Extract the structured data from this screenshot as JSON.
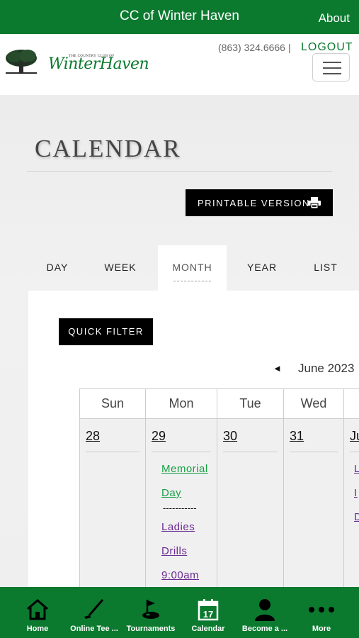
{
  "topbar": {
    "title": "CC of Winter Haven",
    "about": "About"
  },
  "header": {
    "logo_small": "THE COUNTRY CLUB OF",
    "logo_main": "WinterHaven",
    "phone": "(863) 324.6666",
    "separator": "|",
    "logout": "LOGOUT"
  },
  "page": {
    "title": "CALENDAR",
    "print_label": "PRINTABLE VERSION"
  },
  "tabs": [
    {
      "label": "DAY",
      "active": false
    },
    {
      "label": "WEEK",
      "active": false
    },
    {
      "label": "MONTH",
      "active": true
    },
    {
      "label": "YEAR",
      "active": false
    },
    {
      "label": "LIST",
      "active": false
    }
  ],
  "calendar": {
    "quick_filter": "QUICK FILTER",
    "prev_arrow": "◄",
    "month_label": "June 2023",
    "day_headers": [
      "Sun",
      "Mon",
      "Tue",
      "Wed",
      ""
    ],
    "days": [
      {
        "num": "28",
        "events": []
      },
      {
        "num": "29",
        "events": [
          {
            "text": "Memorial",
            "color": "green"
          },
          {
            "text": "Day",
            "color": "green"
          },
          {
            "text": "Ladies",
            "color": "purple"
          },
          {
            "text": "Drills",
            "color": "purple"
          },
          {
            "text": "9:00am",
            "color": "purple"
          }
        ],
        "divider": "-----------"
      },
      {
        "num": "30",
        "events": []
      },
      {
        "num": "31",
        "events": []
      },
      {
        "num": "Ju",
        "events": [
          {
            "text": "L",
            "color": "purple"
          },
          {
            "text": "I",
            "color": "purple"
          },
          {
            "text": "D",
            "color": "purple"
          }
        ]
      }
    ]
  },
  "colors": {
    "brand_green": "#0b7a2f",
    "event_green": "#17a045",
    "event_purple": "#6a2a91"
  },
  "bottom_nav": [
    {
      "label": "Home",
      "icon": "home-icon"
    },
    {
      "label": "Online Tee ...",
      "icon": "golf-club-icon"
    },
    {
      "label": "Tournaments",
      "icon": "golf-hole-icon"
    },
    {
      "label": "Calendar",
      "icon": "calendar-icon",
      "icon_text": "17"
    },
    {
      "label": "Become a ...",
      "icon": "person-icon"
    },
    {
      "label": "More",
      "icon": "more-dots-icon"
    }
  ]
}
